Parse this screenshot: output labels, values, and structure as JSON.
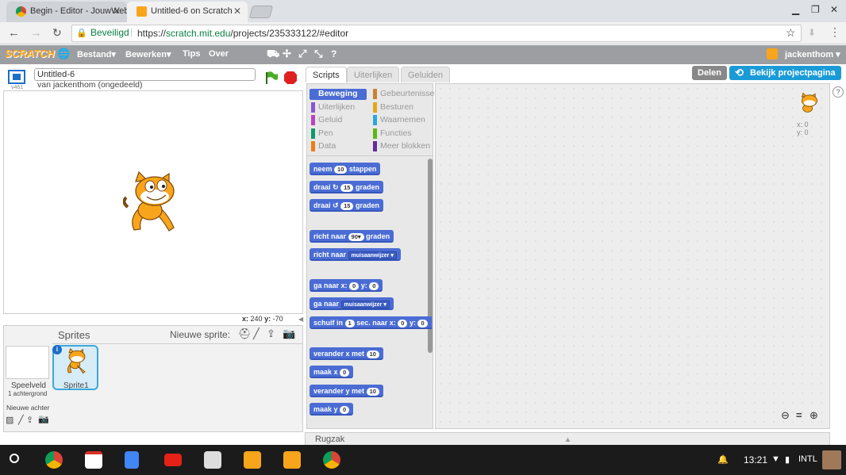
{
  "browser": {
    "tabs": [
      {
        "title": "Begin - Editor - JouwWeb"
      },
      {
        "title": "Untitled-6 on Scratch"
      }
    ],
    "secure_label": "Beveiligd",
    "url_scheme": "https://",
    "url_host": "scratch.mit.edu",
    "url_path": "/projects/235333122/#editor"
  },
  "scratch": {
    "logo": "SCRATCH",
    "menu": [
      "Bestand▾",
      "Bewerken▾",
      "Tips",
      "Over"
    ],
    "user": "jackenthom ▾",
    "version": "v461",
    "project_title": "Untitled-6",
    "byline": "van jackenthom (ongedeeld)",
    "coords_x_label": "x:",
    "coords_x": "240",
    "coords_y_label": "y:",
    "coords_y": "-70",
    "sprites_header": "Sprites",
    "new_sprite": "Nieuwe sprite:",
    "stage_label": "Speelveld",
    "stage_backdrops": "1 achtergrond",
    "new_backdrop": "Nieuwe achter",
    "sprite_name": "Sprite1",
    "editor_tabs": [
      "Scripts",
      "Uiterlijken",
      "Geluiden"
    ],
    "share": "Delen",
    "view_page": "Bekijk projectpagina",
    "categories_left": [
      {
        "label": "Beweging",
        "color": "#4a6cd4",
        "active": true
      },
      {
        "label": "Uiterlijken",
        "color": "#8a55d7"
      },
      {
        "label": "Geluid",
        "color": "#bb42c3"
      },
      {
        "label": "Pen",
        "color": "#0e9a6c"
      },
      {
        "label": "Data",
        "color": "#ee7d16"
      }
    ],
    "categories_right": [
      {
        "label": "Gebeurtenissen",
        "color": "#c88330"
      },
      {
        "label": "Besturen",
        "color": "#e1a91a"
      },
      {
        "label": "Waarnemen",
        "color": "#2ca5e2"
      },
      {
        "label": "Functies",
        "color": "#5cb712"
      },
      {
        "label": "Meer blokken",
        "color": "#632d99"
      }
    ],
    "blocks": {
      "move": [
        "neem",
        "10",
        "stappen"
      ],
      "turn_right": [
        "draai",
        "↻",
        "15",
        "graden"
      ],
      "turn_left": [
        "draai",
        "↺",
        "15",
        "graden"
      ],
      "point_dir": [
        "richt naar",
        "90▾",
        "graden"
      ],
      "point_to": [
        "richt naar",
        "muisaanwijzer ▾"
      ],
      "goto_xy": [
        "ga naar x:",
        "0",
        "y:",
        "0"
      ],
      "goto": [
        "ga naar",
        "muisaanwijzer ▾"
      ],
      "glide": [
        "schuif in",
        "1",
        "sec. naar x:",
        "0",
        "y:",
        "0"
      ],
      "change_x": [
        "verander x met",
        "10"
      ],
      "set_x": [
        "maak x",
        "0"
      ],
      "change_y": [
        "verander y met",
        "10"
      ],
      "set_y": [
        "maak y",
        "0"
      ]
    },
    "sprite_info_x": "x: 0",
    "sprite_info_y": "y: 0",
    "rugzak": "Rugzak"
  },
  "shelf": {
    "time": "13:21",
    "locale": "INTL"
  }
}
